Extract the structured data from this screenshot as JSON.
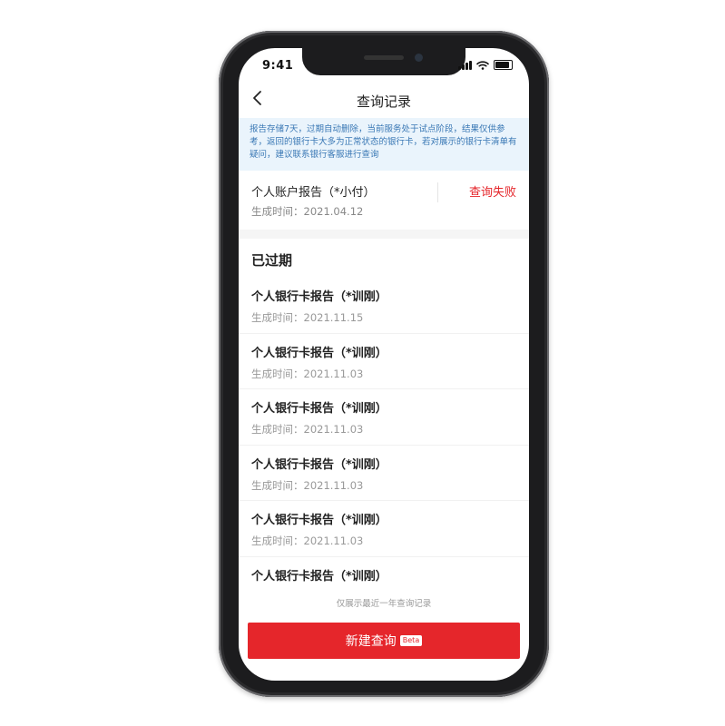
{
  "status_bar": {
    "time": "9:41"
  },
  "nav": {
    "back_icon": "back-arrow-icon",
    "title": "查询记录"
  },
  "notice": {
    "text": "报告存储7天，过期自动删除，当前服务处于试点阶段，结果仅供参考，返回的银行卡大多为正常状态的银行卡，若对展示的银行卡清单有疑问，建议联系银行客服进行查询"
  },
  "active_report": {
    "title": "个人账户报告（*小付）",
    "date": "生成时间：2021.04.12",
    "status": "查询失败",
    "status_color": "#e5262b"
  },
  "expired_section": {
    "title": "已过期"
  },
  "expired_items": [
    {
      "title": "个人银行卡报告（*训刚）",
      "date": "生成时间：2021.11.15"
    },
    {
      "title": "个人银行卡报告（*训刚）",
      "date": "生成时间：2021.11.03"
    },
    {
      "title": "个人银行卡报告（*训刚）",
      "date": "生成时间：2021.11.03"
    },
    {
      "title": "个人银行卡报告（*训刚）",
      "date": "生成时间：2021.11.03"
    },
    {
      "title": "个人银行卡报告（*训刚）",
      "date": "生成时间：2021.11.03"
    },
    {
      "title": "个人银行卡报告（*训刚）",
      "date": ""
    }
  ],
  "footer": {
    "note": "仅展示最近一年查询记录",
    "button_label": "新建查询",
    "badge": "Beta",
    "button_color": "#e5262b"
  }
}
